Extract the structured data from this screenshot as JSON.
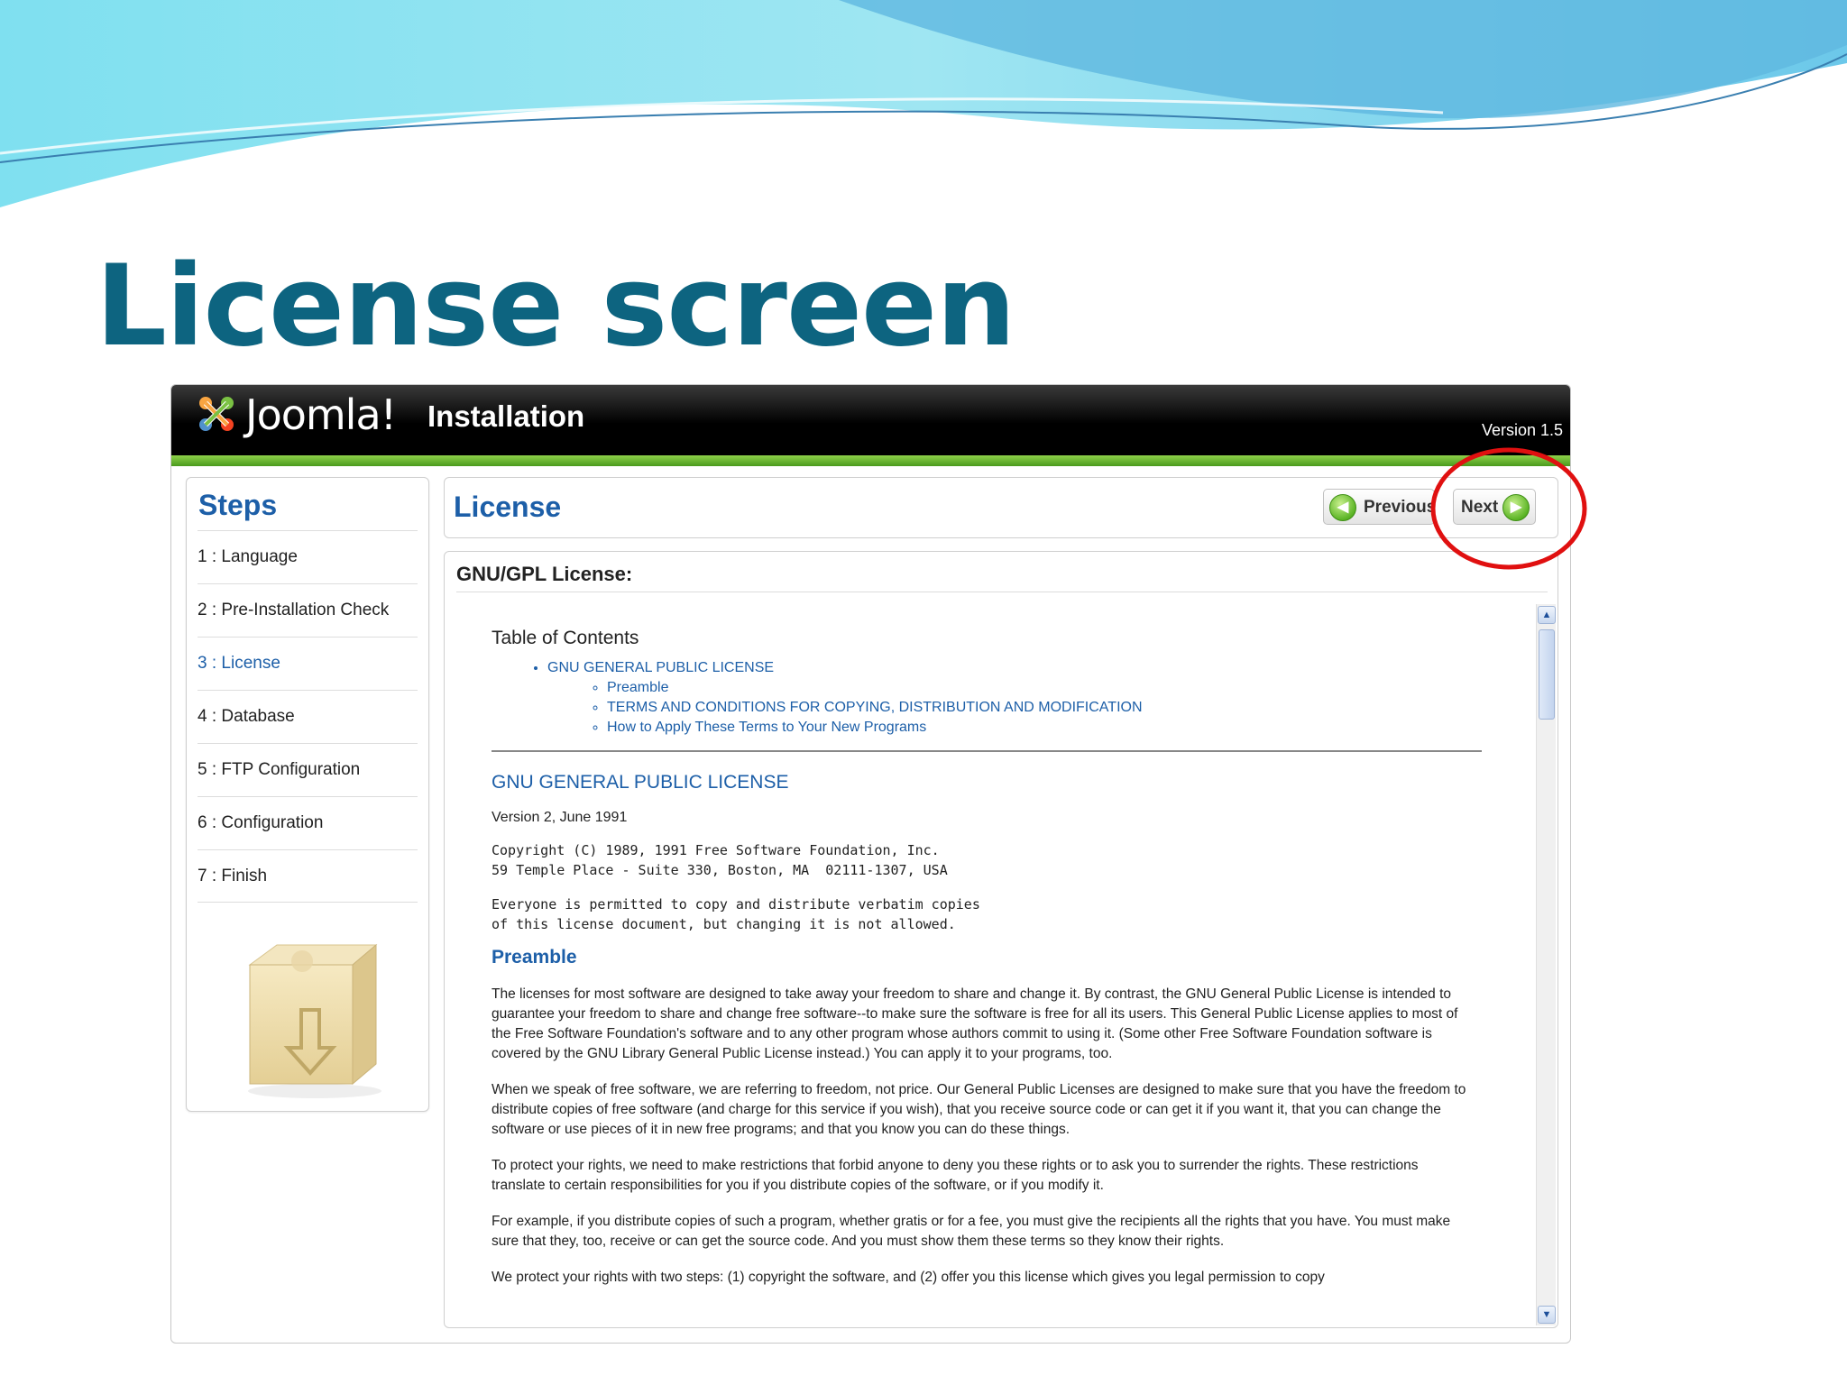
{
  "slide": {
    "title": "License screen"
  },
  "header": {
    "logo_text": "Joomla!",
    "logo_icon": "joomla-logo-icon",
    "title": "Installation",
    "version": "Version 1.5"
  },
  "steps": {
    "title": "Steps",
    "items": [
      {
        "label": "1 : Language",
        "active": false
      },
      {
        "label": "2 : Pre-Installation Check",
        "active": false
      },
      {
        "label": "3 : License",
        "active": true
      },
      {
        "label": "4 : Database",
        "active": false
      },
      {
        "label": "5 : FTP Configuration",
        "active": false
      },
      {
        "label": "6 : Configuration",
        "active": false
      },
      {
        "label": "7 : Finish",
        "active": false
      }
    ],
    "box_icon": "install-box-icon"
  },
  "page": {
    "title": "License",
    "previous_label": "Previous",
    "next_label": "Next"
  },
  "license": {
    "heading": "GNU/GPL License:",
    "toc_title": "Table of Contents",
    "toc_main": "GNU GENERAL PUBLIC LICENSE",
    "toc_sub": [
      "Preamble",
      "TERMS AND CONDITIONS FOR COPYING, DISTRIBUTION AND MODIFICATION",
      "How to Apply These Terms to Your New Programs"
    ],
    "section_title": "GNU GENERAL PUBLIC LICENSE",
    "version_line": "Version 2, June 1991",
    "copyright_1": "Copyright (C) 1989, 1991 Free Software Foundation, Inc.",
    "copyright_2": "59 Temple Place - Suite 330, Boston, MA  02111-1307, USA",
    "permission_1": "Everyone is permitted to copy and distribute verbatim copies",
    "permission_2": "of this license document, but changing it is not allowed.",
    "preamble_title": "Preamble",
    "paragraphs": [
      "The licenses for most software are designed to take away your freedom to share and change it. By contrast, the GNU General Public License is intended to guarantee your freedom to share and change free software--to make sure the software is free for all its users. This General Public License applies to most of the Free Software Foundation's software and to any other program whose authors commit to using it. (Some other Free Software Foundation software is covered by the GNU Library General Public License instead.) You can apply it to your programs, too.",
      "When we speak of free software, we are referring to freedom, not price. Our General Public Licenses are designed to make sure that you have the freedom to distribute copies of free software (and charge for this service if you wish), that you receive source code or can get it if you want it, that you can change the software or use pieces of it in new free programs; and that you know you can do these things.",
      "To protect your rights, we need to make restrictions that forbid anyone to deny you these rights or to ask you to surrender the rights. These restrictions translate to certain responsibilities for you if you distribute copies of the software, or if you modify it.",
      "For example, if you distribute copies of such a program, whether gratis or for a fee, you must give the recipients all the rights that you have. You must make sure that they, too, receive or can get the source code. And you must show them these terms so they know their rights.",
      "We protect your rights with two steps: (1) copyright the software, and (2) offer you this license which gives you legal permission to copy"
    ]
  },
  "colors": {
    "title_teal": "#0d6480",
    "link_blue": "#1d5fa8",
    "header_black": "#000000",
    "green_bar": "#6cbf2e",
    "highlight_red": "#e01010"
  }
}
